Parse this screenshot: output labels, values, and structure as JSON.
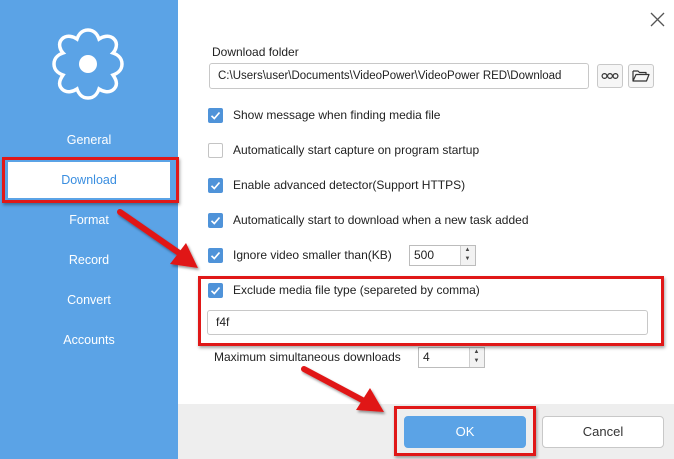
{
  "sidebar": {
    "items": [
      {
        "label": "General"
      },
      {
        "label": "Download"
      },
      {
        "label": "Format"
      },
      {
        "label": "Record"
      },
      {
        "label": "Convert"
      },
      {
        "label": "Accounts"
      }
    ],
    "active": "Download",
    "logo_icon": "gear-icon"
  },
  "settings": {
    "folder_label": "Download folder",
    "folder_value": "C:\\Users\\user\\Documents\\VideoPower\\VideoPower RED\\Download",
    "options": [
      {
        "label": "Show message when finding media file",
        "checked": true
      },
      {
        "label": "Automatically start capture on program startup",
        "checked": false
      },
      {
        "label": "Enable advanced detector(Support HTTPS)",
        "checked": true
      },
      {
        "label": "Automatically start to download when a new task added",
        "checked": true
      },
      {
        "label": "Ignore video smaller than(KB)",
        "checked": true
      },
      {
        "label": "Exclude media file type (separeted by comma)",
        "checked": true
      }
    ],
    "ignore_size_value": "500",
    "exclude_value": "f4f",
    "max_downloads_label": "Maximum simultaneous downloads",
    "max_downloads_value": "4"
  },
  "footer": {
    "ok_label": "OK",
    "cancel_label": "Cancel"
  },
  "colors": {
    "sidebar": "#5ba3e6",
    "accent": "#4f93d9",
    "highlight": "#e01818"
  }
}
